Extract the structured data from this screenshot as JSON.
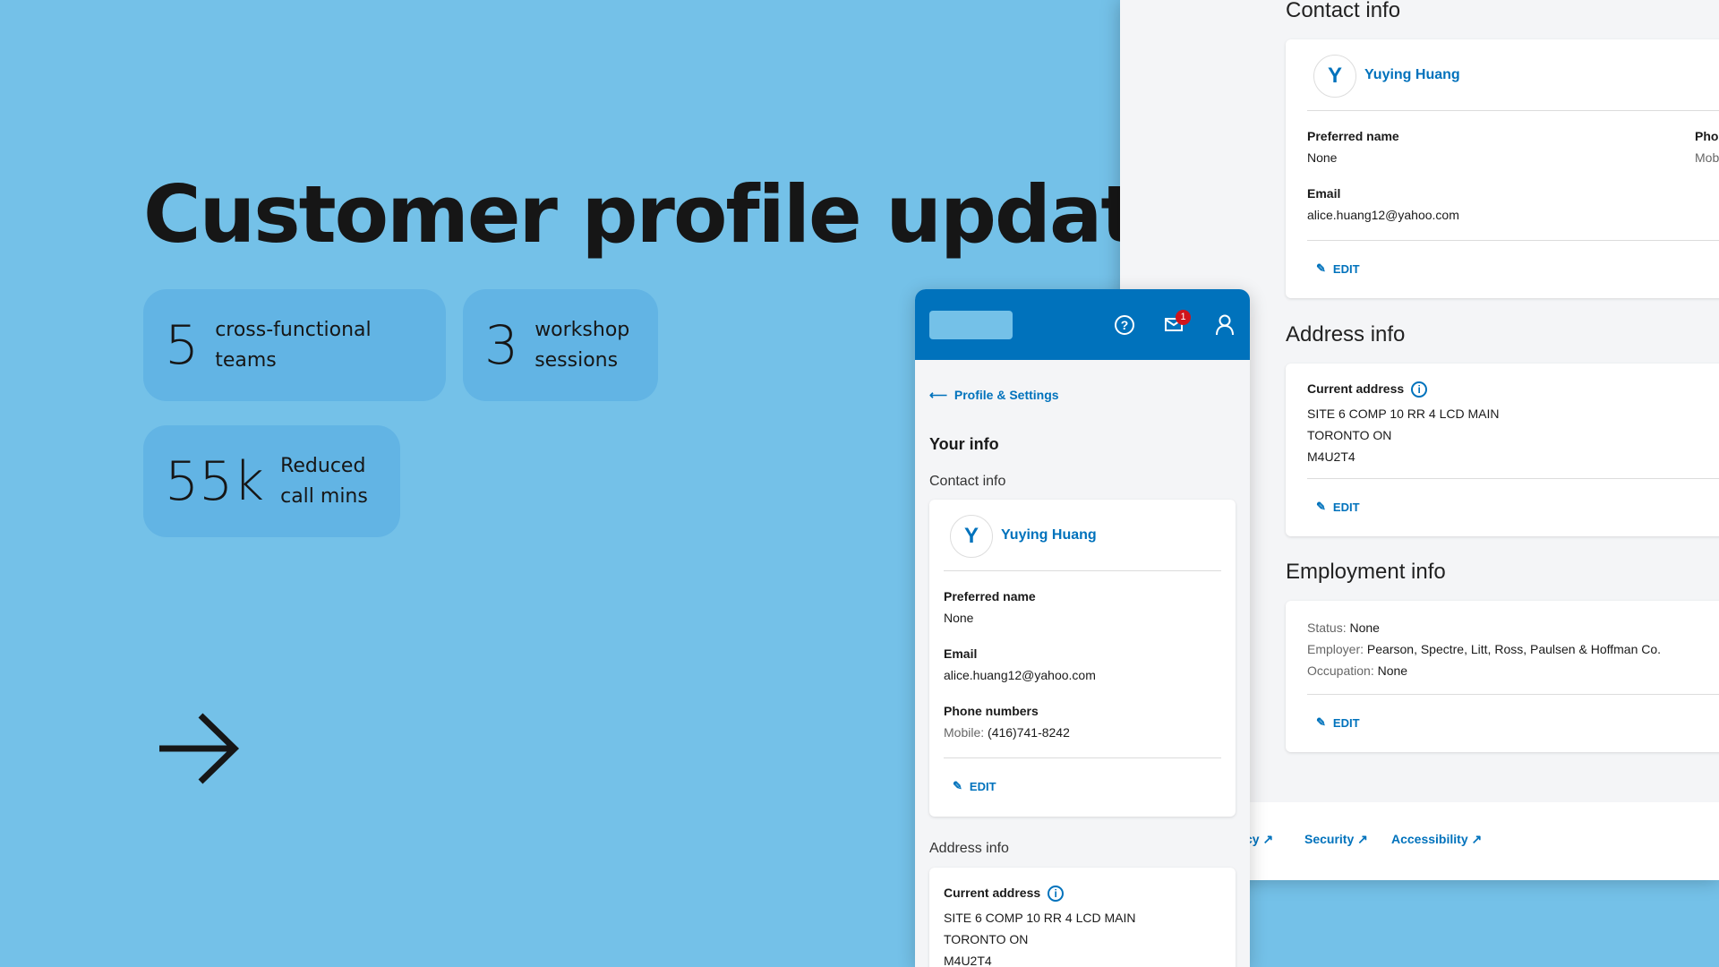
{
  "hero": {
    "title": "Customer profile update",
    "stats": [
      {
        "value": "5",
        "label": "cross-functional teams"
      },
      {
        "value": "3",
        "label_lines": [
          "workshop",
          "sessions"
        ]
      },
      {
        "value": "55k",
        "label_lines": [
          "Reduced",
          "call mins"
        ]
      }
    ],
    "arrow_icon": "arrow-right"
  },
  "desktop": {
    "contact_heading": "Contact info",
    "name": "Yuying Huang",
    "avatar_letter": "Y",
    "preferred_label": "Preferred name",
    "preferred_value": "None",
    "phone_label_partial": "Phon",
    "phone_value_partial": "Mob",
    "email_label": "Email",
    "email_value": "alice.huang12@yahoo.com",
    "edit": "EDIT",
    "address_heading": "Address info",
    "current_address_label": "Current address",
    "address_lines": [
      "SITE 6 COMP 10 RR 4 LCD MAIN",
      "TORONTO ON",
      "M4U2T4"
    ],
    "employment_heading": "Employment info",
    "employment": [
      {
        "k": "Status:",
        "v": "None"
      },
      {
        "k": "Employer:",
        "v": "Pearson, Spectre, Litt, Ross, Paulsen & Hoffman Co."
      },
      {
        "k": "Occupation:",
        "v": "None"
      }
    ],
    "footer_links": [
      "cy",
      "Security",
      "Accessibility"
    ]
  },
  "mobile": {
    "notification_count": "1",
    "back_link": "Profile & Settings",
    "page_title": "Your info",
    "contact_heading": "Contact info",
    "name": "Yuying Huang",
    "avatar_letter": "Y",
    "preferred_label": "Preferred name",
    "preferred_value": "None",
    "email_label": "Email",
    "email_value": "alice.huang12@yahoo.com",
    "phone_label": "Phone numbers",
    "phone_type": "Mobile:",
    "phone_value": "(416)741-8242",
    "edit": "EDIT",
    "address_heading": "Address info",
    "current_address_label": "Current address",
    "address_lines": [
      "SITE 6 COMP 10 RR 4 LCD MAIN",
      "TORONTO ON",
      "M4U2T4"
    ]
  },
  "colors": {
    "background": "#74c1e8",
    "brand": "#0072bc",
    "stat_card": "#62b4e4",
    "badge": "#d0141b"
  }
}
